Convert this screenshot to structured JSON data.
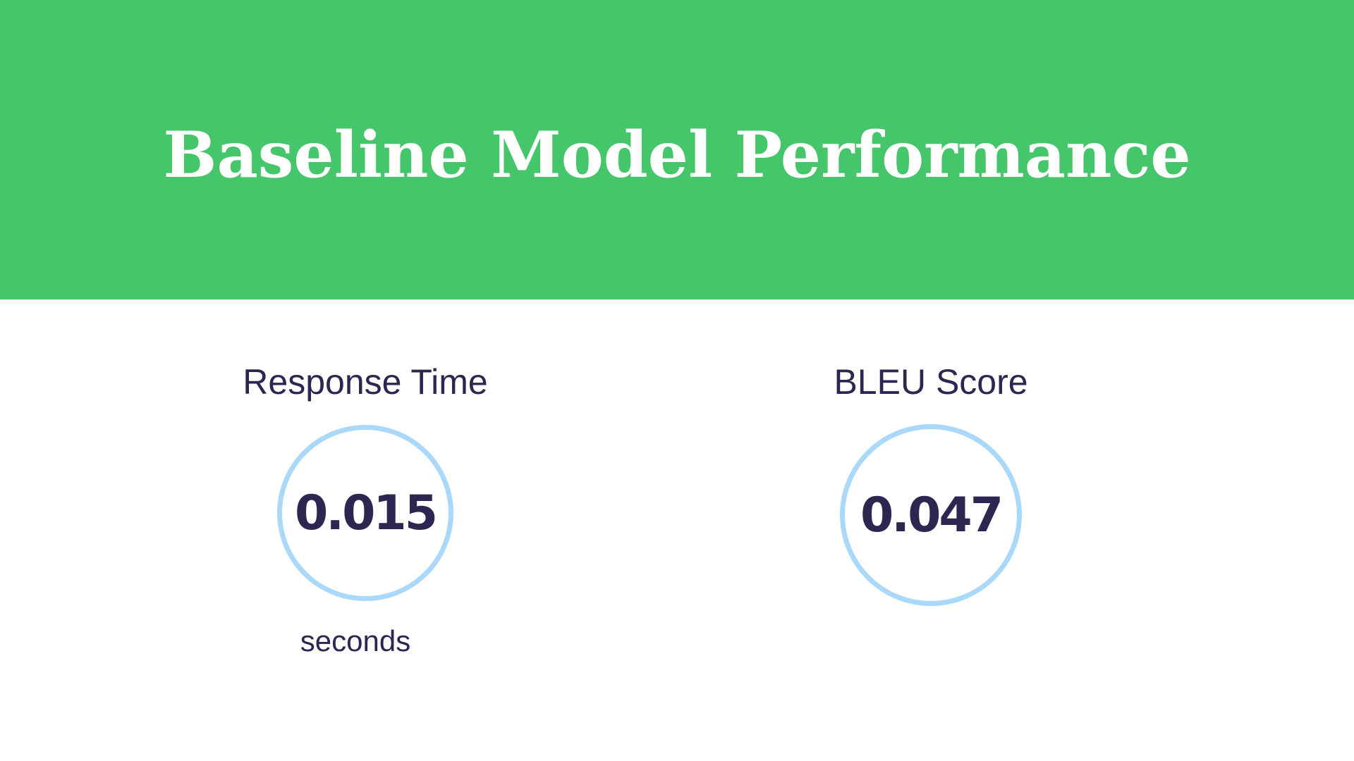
{
  "slide": {
    "title": "Baseline Model Performance",
    "colors": {
      "header_background": "#46c66a",
      "title_text": "#ffffff",
      "body_text": "#2e2650",
      "circle_border": "#a9d8fb"
    }
  },
  "metrics": [
    {
      "label": "Response Time",
      "value": "0.015",
      "unit": "seconds"
    },
    {
      "label": "BLEU Score",
      "value": "0.047"
    }
  ]
}
